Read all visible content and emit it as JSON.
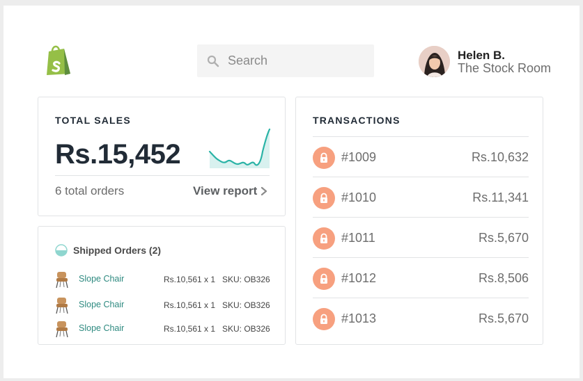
{
  "header": {
    "search_placeholder": "Search",
    "user": {
      "name": "Helen B.",
      "store": "The Stock Room"
    }
  },
  "sales": {
    "title": "TOTAL SALES",
    "amount": "Rs.15,452",
    "orders": "6 total orders",
    "view_report": "View report"
  },
  "shipped": {
    "title": "Shipped Orders (2)",
    "items": [
      {
        "name": "Slope Chair",
        "price": "Rs.10,561 x 1",
        "sku": "SKU: OB326"
      },
      {
        "name": "Slope Chair",
        "price": "Rs.10,561 x 1",
        "sku": "SKU: OB326"
      },
      {
        "name": "Slope Chair",
        "price": "Rs.10,561 x 1",
        "sku": "SKU: OB326"
      }
    ]
  },
  "transactions": {
    "title": "TRANSACTIONS",
    "rows": [
      {
        "id": "#1009",
        "amount": "Rs.10,632"
      },
      {
        "id": "#1010",
        "amount": "Rs.11,341"
      },
      {
        "id": "#1011",
        "amount": "Rs.5,670"
      },
      {
        "id": "#1012",
        "amount": "Rs.8,506"
      },
      {
        "id": "#1013",
        "amount": "Rs.5,670"
      }
    ]
  },
  "colors": {
    "accent_teal": "#2ab3a6",
    "lock_orange": "#f7a07f",
    "shopify_green": "#95bf47"
  },
  "icons": [
    "shopify-logo",
    "search-icon",
    "chevron-right-icon",
    "half-circle-icon",
    "chair-icon",
    "lock-icon"
  ]
}
